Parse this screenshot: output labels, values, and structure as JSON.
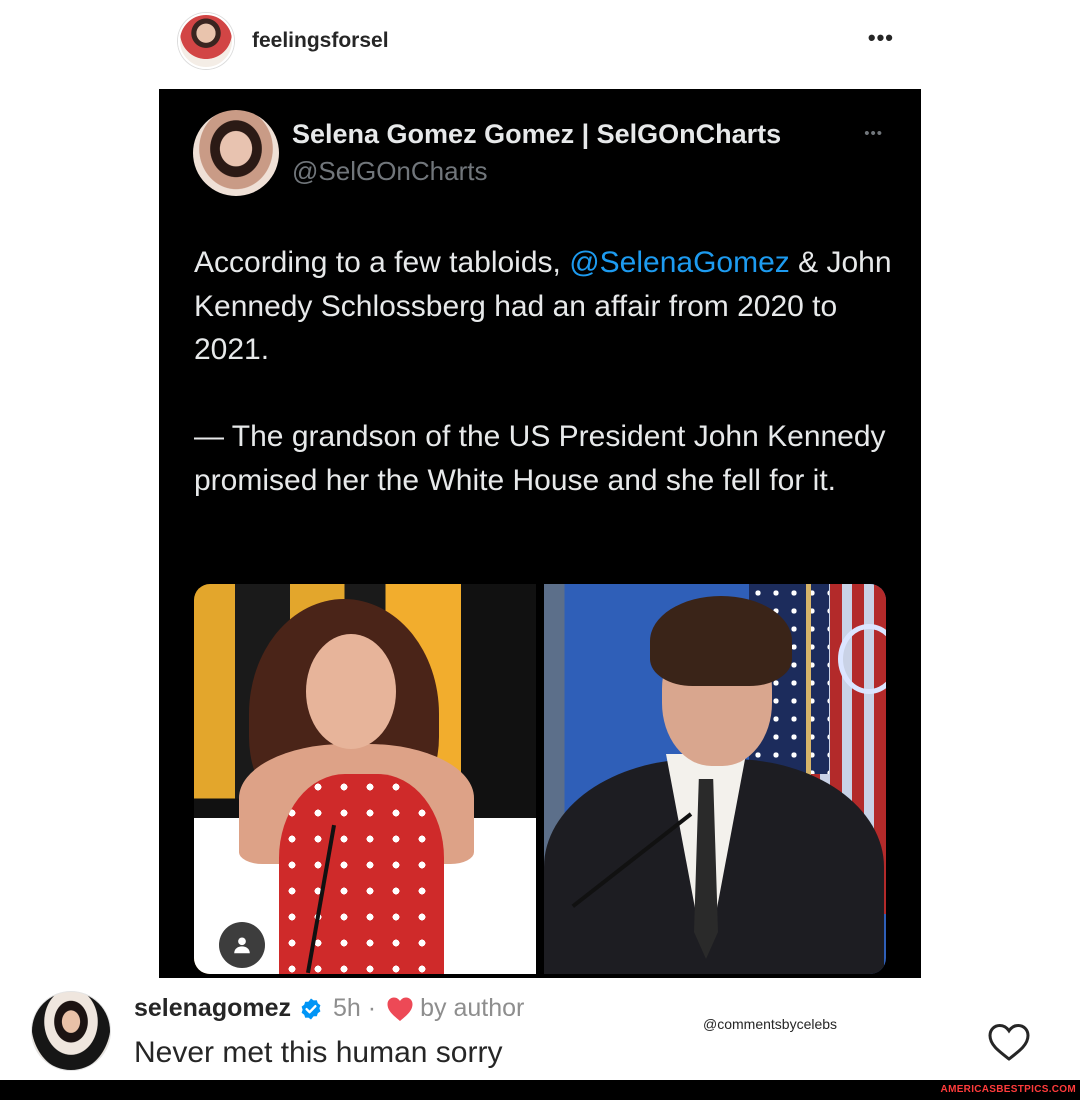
{
  "post": {
    "username": "feelingsforsel",
    "more_label": "•••"
  },
  "tweet": {
    "display_name": "Selena Gomez Gomez | SelGOnCharts",
    "handle": "@SelGOnCharts",
    "more_label": "•••",
    "line1_before": "According to a few tabloids, ",
    "mention": "@SelenaGomez",
    "line1_after": " & John Kennedy Schlossberg had an affair from 2020 to 2021.",
    "paragraph2": "— The grandson of the US President John Kennedy promised her the White House and she fell for it."
  },
  "comment": {
    "username": "selenagomez",
    "time": "5h ·",
    "by_author": "by author",
    "text": "Never met this human sorry",
    "credit": "@commentsbycelebs"
  },
  "footer": {
    "watermark": "AMERICASBESTPICS.COM"
  },
  "colors": {
    "mention_blue": "#1d9bf0",
    "verified_blue": "#0095f6",
    "heart_red": "#ed4956",
    "tweet_bg": "#000000"
  },
  "icons": {
    "post_more": "more-horizontal-icon",
    "tweet_more": "more-horizontal-icon",
    "person_tag": "person-tag-icon",
    "verified": "verified-badge-icon",
    "author_heart": "filled-heart-icon",
    "like": "heart-outline-icon"
  }
}
